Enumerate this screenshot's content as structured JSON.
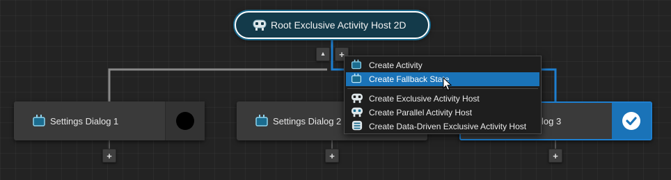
{
  "root": {
    "label": "Root Exclusive Activity Host 2D",
    "icon": "exclusive-host-icon"
  },
  "nodes": [
    {
      "label": "Settings Dialog 1",
      "icon": "activity-icon",
      "indicator": "inactive-dot"
    },
    {
      "label": "Settings Dialog 2",
      "icon": "activity-icon"
    },
    {
      "label": "log 3",
      "indicator": "checkmark-icon"
    }
  ],
  "toolbar": {
    "collapse_glyph": "▴",
    "add_glyph": "+"
  },
  "context_menu": {
    "items": [
      {
        "label": "Create Activity",
        "icon": "activity-icon"
      },
      {
        "label": "Create Fallback State",
        "icon": "activity-icon",
        "selected": true
      },
      {
        "label": "Create Exclusive Activity Host",
        "icon": "exclusive-host-icon"
      },
      {
        "label": "Create Parallel Activity Host",
        "icon": "parallel-host-icon"
      },
      {
        "label": "Create Data-Driven Exclusive Activity Host",
        "icon": "data-driven-host-icon"
      }
    ]
  },
  "colors": {
    "accent": "#1a73b8",
    "root_fill": "#133a4a",
    "node_fill": "#3a3a3a",
    "selected_node_side": "#1a73b8",
    "link_gray": "#8a8a8a",
    "link_blue": "#1e7fd0"
  }
}
